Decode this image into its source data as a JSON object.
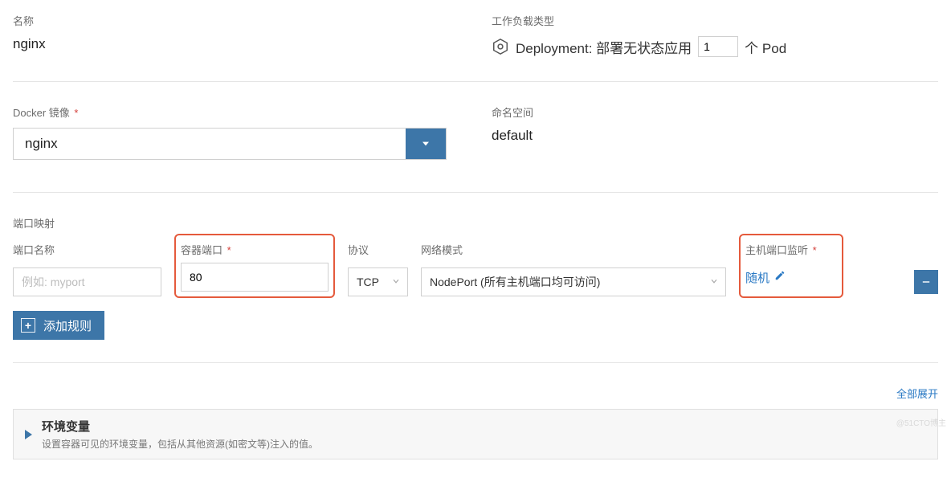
{
  "name": {
    "label": "名称",
    "value": "nginx"
  },
  "workload": {
    "label": "工作负载类型",
    "prefix": "Deployment: 部署无状态应用",
    "pod_count": "1",
    "suffix": "个 Pod"
  },
  "docker_image": {
    "label": "Docker 镜像",
    "value": "nginx"
  },
  "namespace": {
    "label": "命名空间",
    "value": "default"
  },
  "port_map": {
    "title": "端口映射",
    "port_name": {
      "label": "端口名称",
      "placeholder": "例如: myport",
      "value": ""
    },
    "container_port": {
      "label": "容器端口",
      "value": "80"
    },
    "protocol": {
      "label": "协议",
      "value": "TCP"
    },
    "network_mode": {
      "label": "网络模式",
      "value": "NodePort (所有主机端口均可访问)"
    },
    "host_port": {
      "label": "主机端口监听",
      "value": "随机"
    },
    "add_rule": "添加规则"
  },
  "expand_all": "全部展开",
  "env": {
    "title": "环境变量",
    "desc": "设置容器可见的环境变量，包括从其他资源(如密文等)注入的值。"
  },
  "watermark": "@51CTO博主"
}
